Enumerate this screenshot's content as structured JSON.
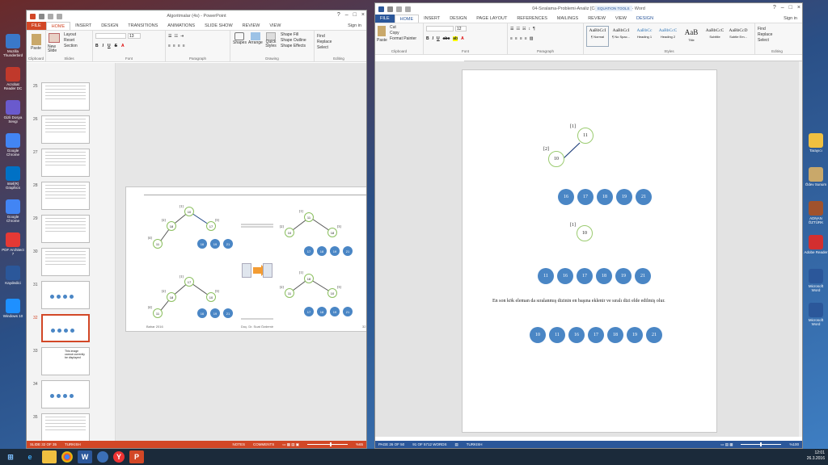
{
  "desktop": {
    "left_icons": [
      "Mozilla Thunderbird",
      "Acrobat Reader DC",
      "Gizli Dosya Sevgi",
      "Google Chrome",
      "Intel(R) Graphics",
      "Google Chrome",
      "PDF Architect 7",
      "Kaydedici",
      "Windows 10"
    ],
    "right_icons": [
      "Tarayıcı",
      "Ödev Sunum",
      "ADNAN ÖZTÜRK",
      "Adobe Reader",
      "Microsoft Word",
      "Microsoft Word"
    ]
  },
  "taskbar": {
    "time": "12:01",
    "date": "26.3.2016"
  },
  "ppt": {
    "title": "Algoritmalar (4s) - PowerPoint",
    "signin": "Sign in",
    "tabs": [
      "FILE",
      "HOME",
      "INSERT",
      "DESIGN",
      "TRANSITIONS",
      "ANIMATIONS",
      "SLIDE SHOW",
      "REVIEW",
      "VIEW"
    ],
    "ribbon": {
      "paste": "Paste",
      "new_slide": "New Slide",
      "layout": "Layout",
      "reset": "Reset",
      "section": "Section",
      "font_size": "13",
      "shapes": "Shapes",
      "arrange": "Arrange",
      "quick_styles": "Quick Styles",
      "shape_fill": "Shape Fill",
      "shape_outline": "Shape Outline",
      "shape_effects": "Shape Effects",
      "find": "Find",
      "replace": "Replace",
      "select": "Select",
      "groups": [
        "Clipboard",
        "Slides",
        "Font",
        "Paragraph",
        "Drawing",
        "Editing"
      ]
    },
    "thumbs": [
      {
        "num": "25"
      },
      {
        "num": "26"
      },
      {
        "num": "27"
      },
      {
        "num": "28"
      },
      {
        "num": "29"
      },
      {
        "num": "30"
      },
      {
        "num": "31"
      },
      {
        "num": "32"
      },
      {
        "num": "33"
      },
      {
        "num": "34"
      },
      {
        "num": "35"
      }
    ],
    "missing_image_text": "This image cannot currently be displayed",
    "slide": {
      "tree1": {
        "root": "10",
        "left": "18",
        "right": "17",
        "leaf": "11",
        "idx_root": "[1]",
        "idx_left": "[2]",
        "idx_right": "[3]",
        "idx_leaf": "[4]"
      },
      "tree1_row": [
        "16",
        "19",
        "21"
      ],
      "tree2": {
        "root": "11",
        "left": "10",
        "right": "18",
        "idx_root": "[1]",
        "idx_left": "[2]",
        "idx_right": "[3]"
      },
      "tree2_row": [
        "17",
        "18",
        "19",
        "21"
      ],
      "tree3": {
        "root": "17",
        "left": "18",
        "right": "10",
        "leaf": "11",
        "idx_root": "[1]",
        "idx_left": "[2]",
        "idx_right": "[3]",
        "idx_leaf": "[4]"
      },
      "tree3_row": [
        "16",
        "19",
        "21"
      ],
      "tree4": {
        "root": "18",
        "left": "11",
        "right": "10",
        "idx_root": "[1]",
        "idx_left": "[2]",
        "idx_right": "[3]"
      },
      "tree4_row": [
        "17",
        "18",
        "19",
        "21"
      ],
      "footer_left": "Bahar 2016",
      "footer_mid": "Doç. Dr. Suat Özdemir",
      "footer_right": "32"
    },
    "status": {
      "slide": "SLIDE 32 OF 35",
      "lang": "TURKISH",
      "notes": "NOTES",
      "comments": "COMMENTS",
      "zoom": "%65"
    }
  },
  "word": {
    "title": "04-Sıralama-Problemi-Analiz [Compatibility Mode] - Word",
    "equation_tools": "EQUATION TOOLS",
    "signin": "Sign in",
    "tabs": [
      "FILE",
      "HOME",
      "INSERT",
      "DESIGN",
      "PAGE LAYOUT",
      "REFERENCES",
      "MAILINGS",
      "REVIEW",
      "VIEW",
      "DESIGN"
    ],
    "ribbon": {
      "cut": "Cut",
      "copy": "Copy",
      "format_painter": "Format Painter",
      "paste": "Paste",
      "font_size": "12",
      "styles": [
        {
          "preview": "AaBbCcI",
          "name": "¶ Normal"
        },
        {
          "preview": "AaBbCcI",
          "name": "¶ No Spac..."
        },
        {
          "preview": "AaBbCc",
          "name": "Heading 1"
        },
        {
          "preview": "AaBbCcC",
          "name": "Heading 2"
        },
        {
          "preview": "AaB",
          "name": "Title"
        },
        {
          "preview": "AaBbCcC",
          "name": "Subtitle"
        },
        {
          "preview": "AaBbCcD",
          "name": "Subtle Em..."
        }
      ],
      "find": "Find",
      "replace": "Replace",
      "select": "Select",
      "groups": [
        "Clipboard",
        "Font",
        "Paragraph",
        "Styles",
        "Editing"
      ]
    },
    "doc": {
      "tree_a": {
        "root": "11",
        "child": "10",
        "idx_root": "[1]",
        "idx_child": "[2]"
      },
      "row_a": [
        "16",
        "17",
        "18",
        "19",
        "21"
      ],
      "single": {
        "node": "10",
        "idx": "[1]"
      },
      "row_b": [
        "11",
        "16",
        "17",
        "18",
        "19",
        "21"
      ],
      "sentence": "En son kök eleman da sıralanmış dizinin en başına eklenir ve sıralı dizi elde edilmiş olur.",
      "row_c": [
        "10",
        "11",
        "16",
        "17",
        "18",
        "19",
        "21"
      ]
    },
    "status": {
      "page": "PAGE 26 OF 50",
      "words": "91 OF 5712 WORDS",
      "lang": "TURKISH",
      "zoom": "%100"
    }
  },
  "colors": {
    "ppt_accent": "#d24726",
    "word_accent": "#2b579a",
    "bubble": "#4a86c5",
    "node_border": "#8bbf5f"
  }
}
